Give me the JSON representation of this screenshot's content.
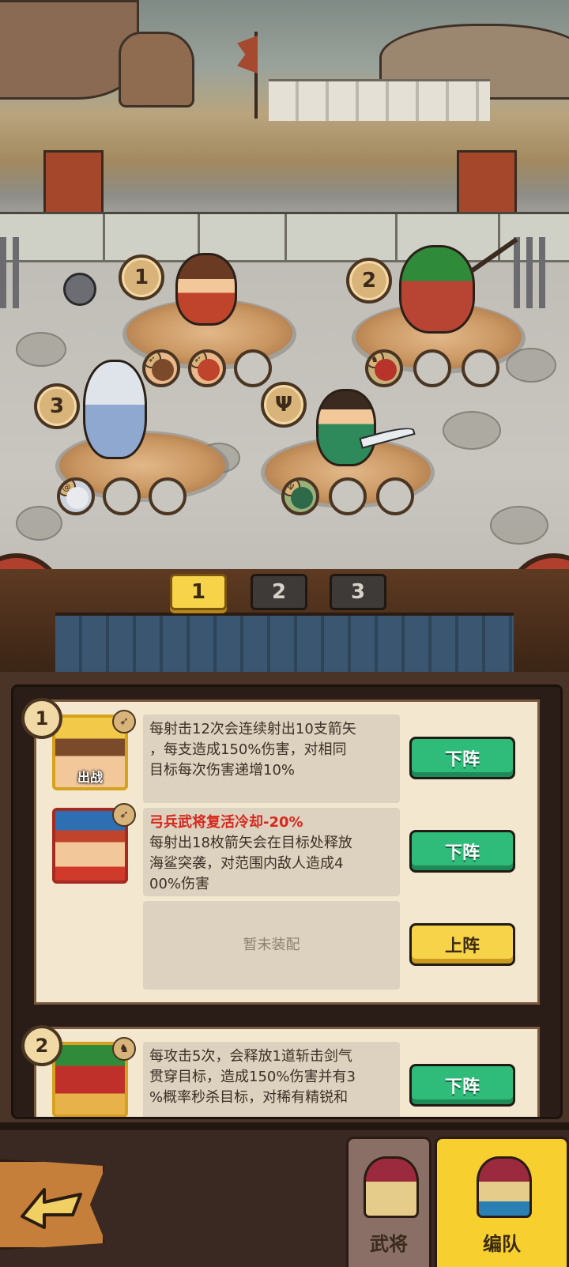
{
  "formation_tabs": [
    {
      "label": "1",
      "active": true
    },
    {
      "label": "2",
      "active": false
    },
    {
      "label": "3",
      "active": false
    }
  ],
  "battlefield": {
    "position_badges": [
      "1",
      "2",
      "3"
    ],
    "hero_4_badge_icon": "trident-icon"
  },
  "panels": [
    {
      "number": "1",
      "rows": [
        {
          "portrait_tag": "出战",
          "role_icon": "bow-icon",
          "description_lines": [
            "每射击12次会连续射出10支箭矢",
            "，每支造成150%伤害，对相同",
            "目标每次伤害递增10%"
          ],
          "button": "下阵",
          "button_type": "green"
        },
        {
          "portrait_tag": "",
          "role_icon": "bow-icon",
          "bonus": "弓兵武将复活冷却-20%",
          "description_lines": [
            "每射出18枚箭矢会在目标处释放",
            "海鲨突袭，对范围内敌人造成4",
            "00%伤害"
          ],
          "button": "下阵",
          "button_type": "green"
        },
        {
          "empty_text": "暂未装配",
          "button": "上阵",
          "button_type": "yellow"
        }
      ]
    },
    {
      "number": "2",
      "rows": [
        {
          "role_icon": "horse-icon",
          "description_lines": [
            "每攻击5次，会释放1道斩击剑气",
            "贯穿目标，造成150%伤害并有3",
            "%概率秒杀目标，对稀有精锐和"
          ],
          "button": "下阵",
          "button_type": "green"
        }
      ]
    }
  ],
  "bottom_nav": {
    "generals_label": "武将",
    "formation_label": "编队",
    "back_icon": "back-arrow-icon"
  },
  "colors": {
    "accent_yellow": "#f7d34a",
    "accent_green": "#2fbb7a",
    "bonus_red": "#d8281e",
    "frame_brown": "#4a3427"
  }
}
